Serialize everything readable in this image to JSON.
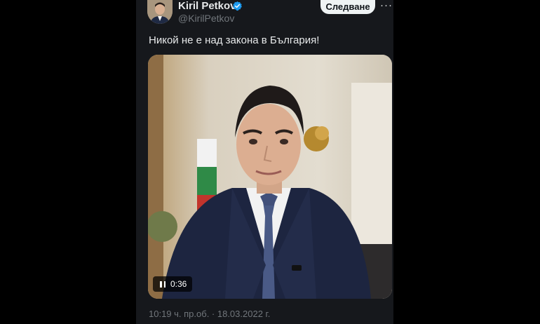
{
  "tweet": {
    "author_name": "Kiril Petkov",
    "handle": "@KirilPetkov",
    "follow_label": "Следване",
    "more_label": "···",
    "text": "Никой не е над закона в България!",
    "timestamp": "10:19 ч. пр.об. · 18.03.2022 г."
  },
  "video": {
    "elapsed": "0:36",
    "state": "playing"
  },
  "colors": {
    "background": "#000000",
    "panel": "#16181c",
    "verified": "#1d9bf0",
    "secondary_text": "#71767b"
  },
  "icons": {
    "verified": "verified-badge-icon",
    "pause": "pause-icon",
    "more": "more-options-icon"
  }
}
